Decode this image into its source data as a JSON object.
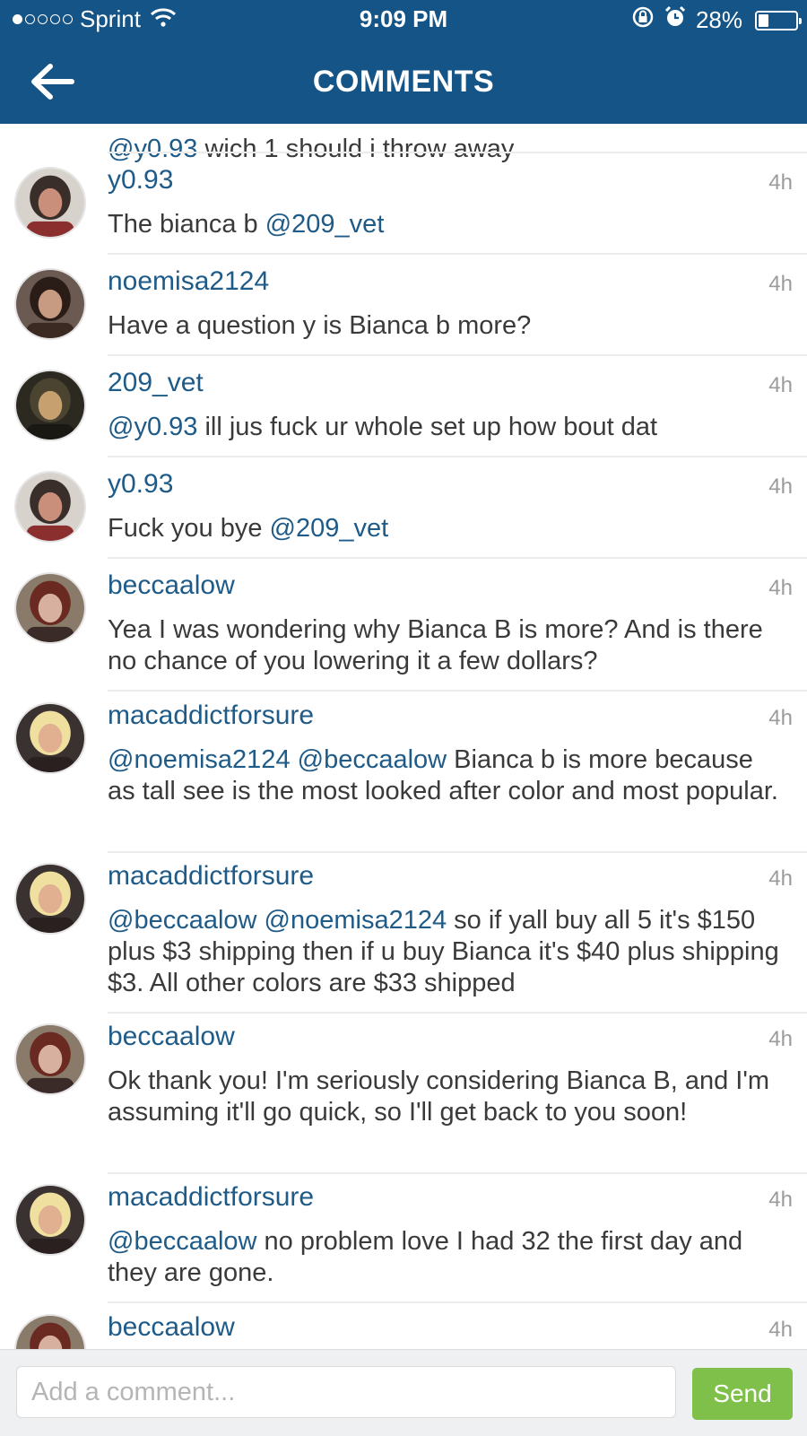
{
  "status_bar": {
    "carrier": "Sprint",
    "signal_filled": 1,
    "signal_total": 5,
    "time": "9:09 PM",
    "battery": "28%",
    "battery_level": 0.28
  },
  "header": {
    "title": "COMMENTS"
  },
  "comments": [
    {
      "user": "",
      "time": "",
      "parts": [
        {
          "t": "@y0.93",
          "m": true
        },
        {
          "t": " wich 1 should i throw away",
          "m": false
        }
      ]
    },
    {
      "user": "y0.93",
      "time": "4h",
      "parts": [
        {
          "t": "The bianca b ",
          "m": false
        },
        {
          "t": "@209_vet",
          "m": true
        }
      ]
    },
    {
      "user": "noemisa2124",
      "time": "4h",
      "parts": [
        {
          "t": "Have a question y is Bianca b more?",
          "m": false
        }
      ]
    },
    {
      "user": "209_vet",
      "time": "4h",
      "parts": [
        {
          "t": "@y0.93",
          "m": true
        },
        {
          "t": " ill jus fuck ur whole set up how bout dat",
          "m": false
        }
      ]
    },
    {
      "user": "y0.93",
      "time": "4h",
      "parts": [
        {
          "t": "Fuck you bye ",
          "m": false
        },
        {
          "t": "@209_vet",
          "m": true
        }
      ]
    },
    {
      "user": "beccaalow",
      "time": "4h",
      "parts": [
        {
          "t": "Yea I was wondering why Bianca B is more? And is there no chance of you lowering it a few dollars?",
          "m": false
        }
      ]
    },
    {
      "user": "macaddictforsure",
      "time": "4h",
      "parts": [
        {
          "t": "@noemisa2124",
          "m": true
        },
        {
          "t": " ",
          "m": false
        },
        {
          "t": "@beccaalow",
          "m": true
        },
        {
          "t": " Bianca b is more because as tall see is the most looked after color and most popular.",
          "m": false
        }
      ]
    },
    {
      "user": "macaddictforsure",
      "time": "4h",
      "parts": [
        {
          "t": "@beccaalow",
          "m": true
        },
        {
          "t": " ",
          "m": false
        },
        {
          "t": "@noemisa2124",
          "m": true
        },
        {
          "t": " so if yall buy all 5 it's $150 plus $3 shipping then if u buy Bianca it's $40 plus shipping $3. All other colors are $33 shipped",
          "m": false
        }
      ]
    },
    {
      "user": "beccaalow",
      "time": "4h",
      "parts": [
        {
          "t": "Ok thank you! I'm seriously considering Bianca B, and I'm assuming it'll go quick, so I'll get back to you soon!",
          "m": false
        }
      ]
    },
    {
      "user": "macaddictforsure",
      "time": "4h",
      "parts": [
        {
          "t": "@beccaalow",
          "m": true
        },
        {
          "t": " no problem love I had 32 the first day and they are gone.",
          "m": false
        }
      ]
    },
    {
      "user": "beccaalow",
      "time": "4h",
      "parts": []
    }
  ],
  "composer": {
    "placeholder": "Add a comment...",
    "value": "",
    "send_label": "Send"
  },
  "colors": {
    "header": "#155486",
    "link": "#1f5b88",
    "send": "#7fc04a"
  }
}
